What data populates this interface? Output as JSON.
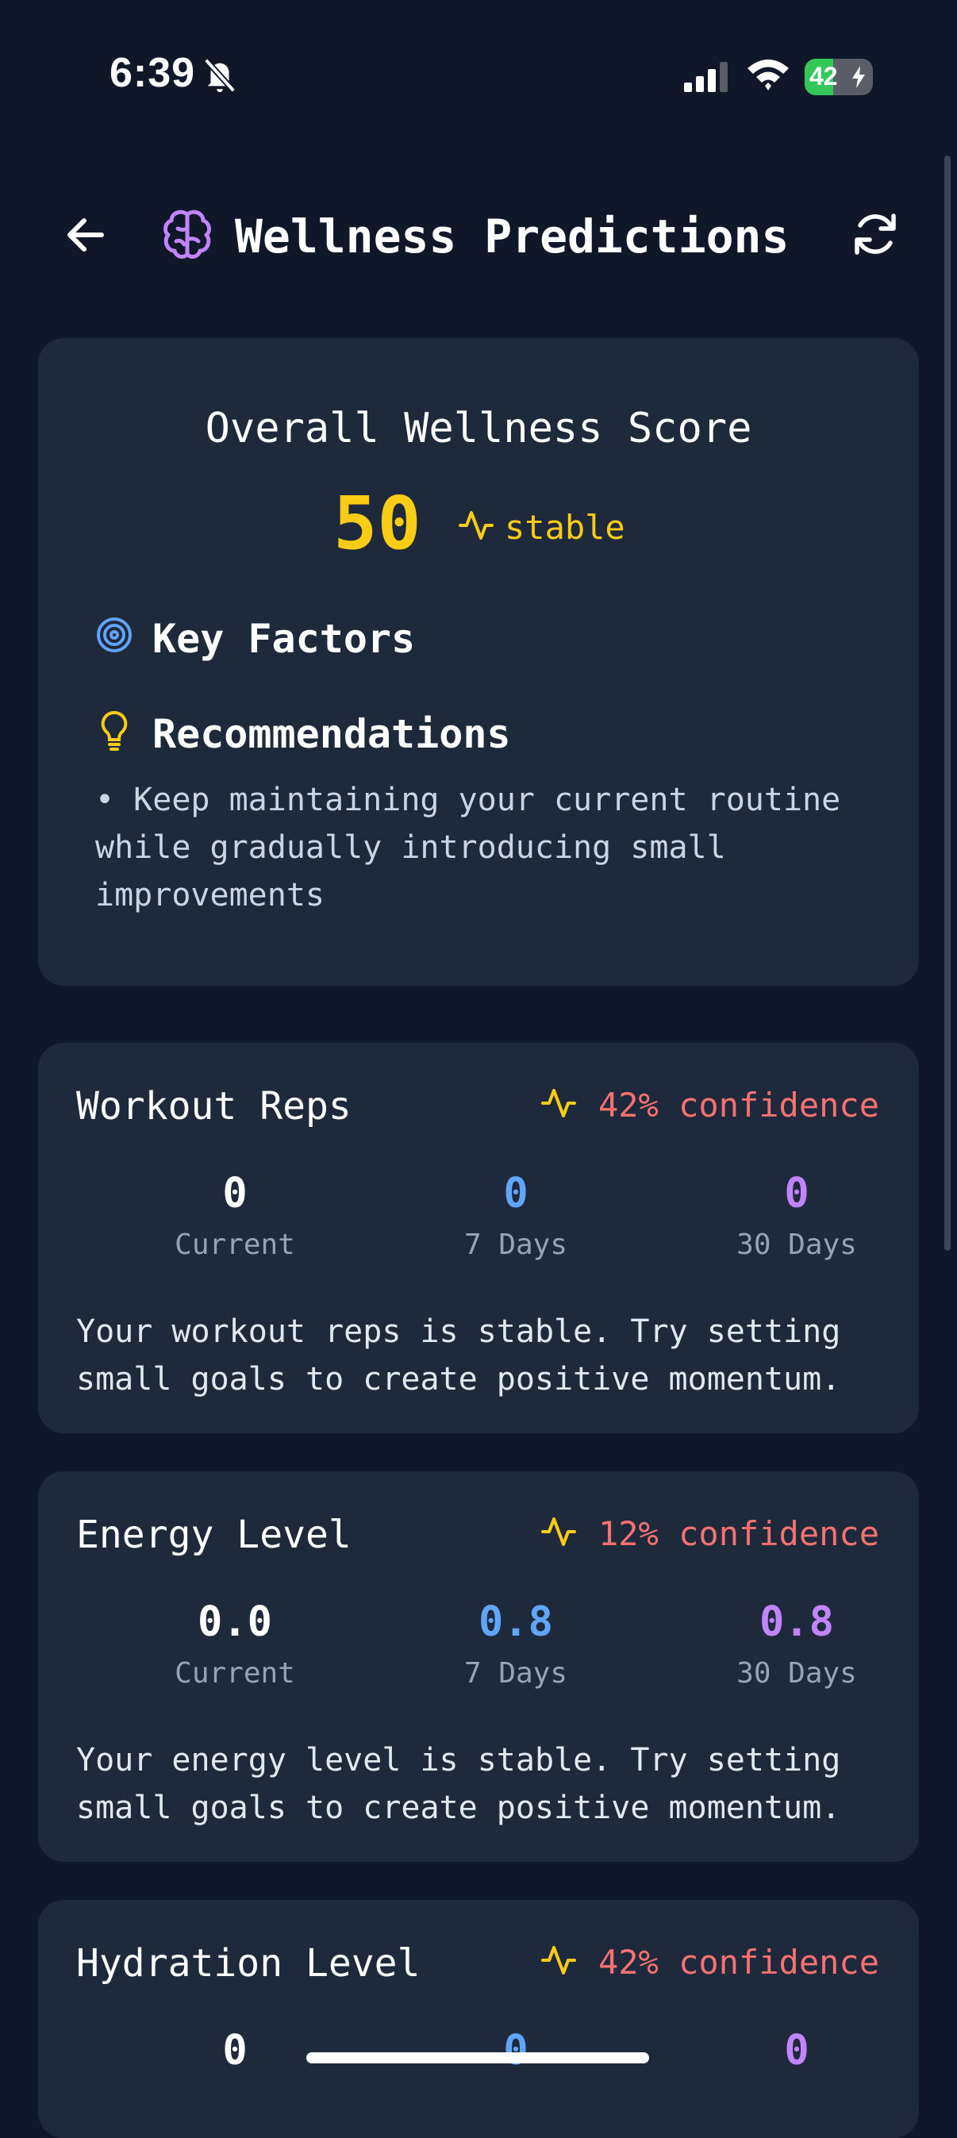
{
  "status_bar": {
    "time": "6:39",
    "battery": "42",
    "battery_level": 0.42
  },
  "header": {
    "title": "Wellness Predictions"
  },
  "overall": {
    "title": "Overall Wellness Score",
    "score": "50",
    "trend": "stable",
    "key_factors_label": "Key Factors",
    "recommendations_label": "Recommendations",
    "recommendation": "• Keep maintaining your current routine while gradually introducing small improvements"
  },
  "metrics": [
    {
      "title": "Workout Reps",
      "confidence": "42% confidence",
      "current": "0",
      "seven_days": "0",
      "thirty_days": "0",
      "current_label": "Current",
      "seven_label": "7 Days",
      "thirty_label": "30 Days",
      "text": "Your workout reps is stable. Try setting small goals to create positive momentum."
    },
    {
      "title": "Energy Level",
      "confidence": "12% confidence",
      "current": "0.0",
      "seven_days": "0.8",
      "thirty_days": "0.8",
      "current_label": "Current",
      "seven_label": "7 Days",
      "thirty_label": "30 Days",
      "text": "Your energy level is stable. Try setting small goals to create positive momentum."
    },
    {
      "title": "Hydration Level",
      "confidence": "42% confidence",
      "current": "0",
      "seven_days": "0",
      "thirty_days": "0"
    }
  ],
  "colors": {
    "background": "#0f1729",
    "card": "#1e293b",
    "score": "#facc15",
    "confidence": "#f87171",
    "seven_days": "#60a5fa",
    "thirty_days": "#c084fc",
    "brain": "#c084fc",
    "target": "#60a5fa",
    "lightbulb": "#facc15"
  },
  "icons": {
    "back": "arrow-left-icon",
    "brain": "brain-icon",
    "refresh": "refresh-icon",
    "trend": "activity-icon",
    "key_factors": "target-icon",
    "recommendations": "lightbulb-icon"
  }
}
